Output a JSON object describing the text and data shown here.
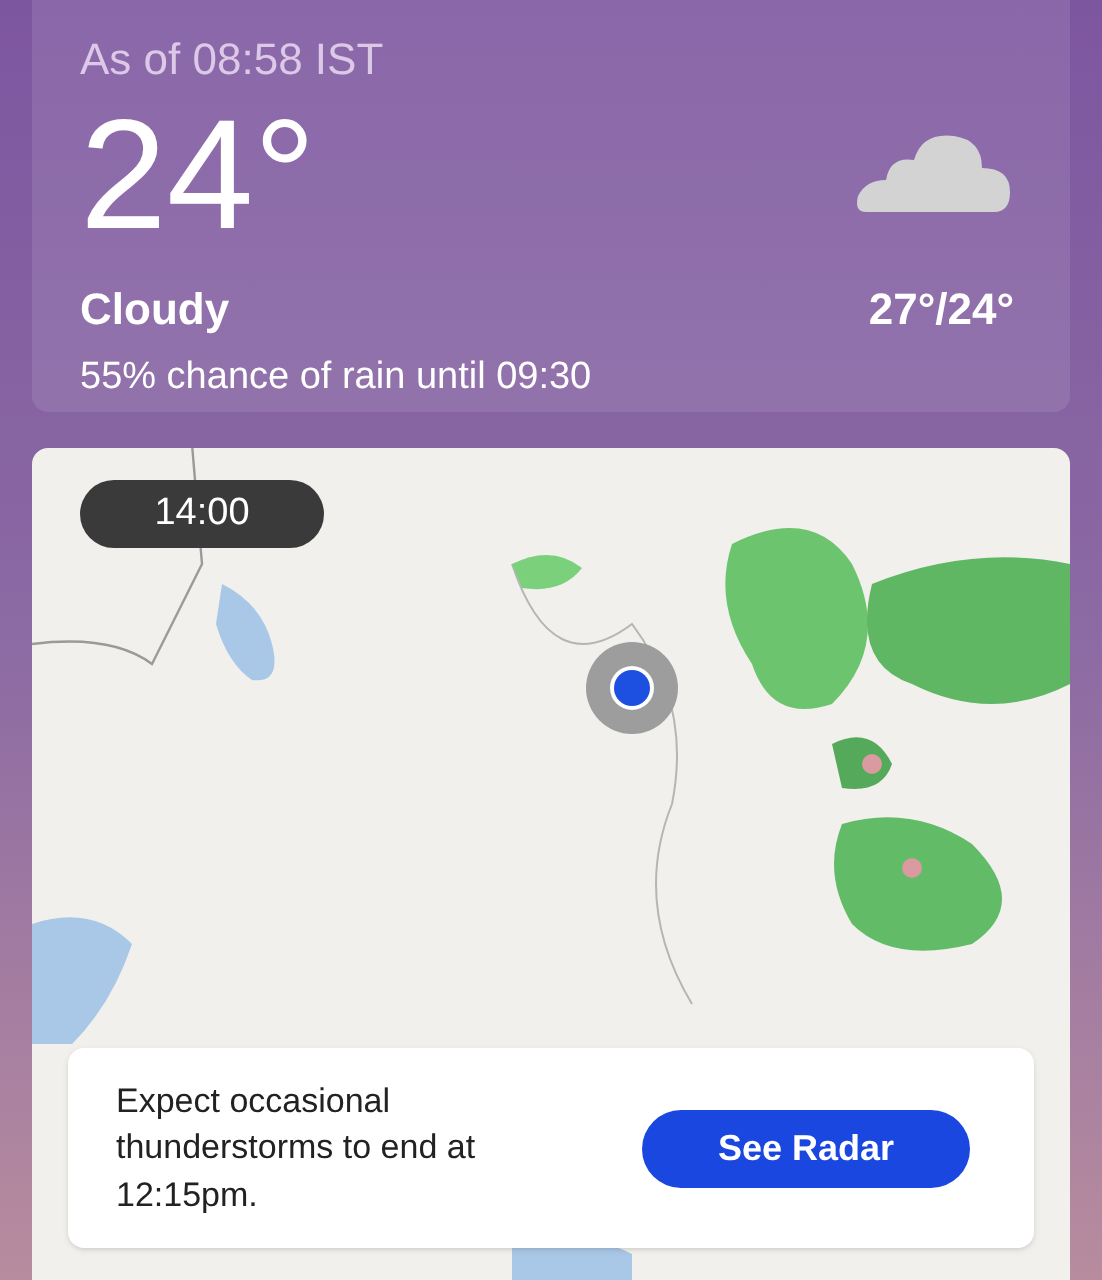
{
  "current": {
    "as_of": "As of 08:58 IST",
    "temperature": "24°",
    "condition": "Cloudy",
    "rain_chance": "55% chance of rain until 09:30",
    "high_low": "27°/24°"
  },
  "radar": {
    "time": "14:00",
    "message": "Expect occasional thunderstorms to end at 12:15pm.",
    "button": "See Radar"
  }
}
